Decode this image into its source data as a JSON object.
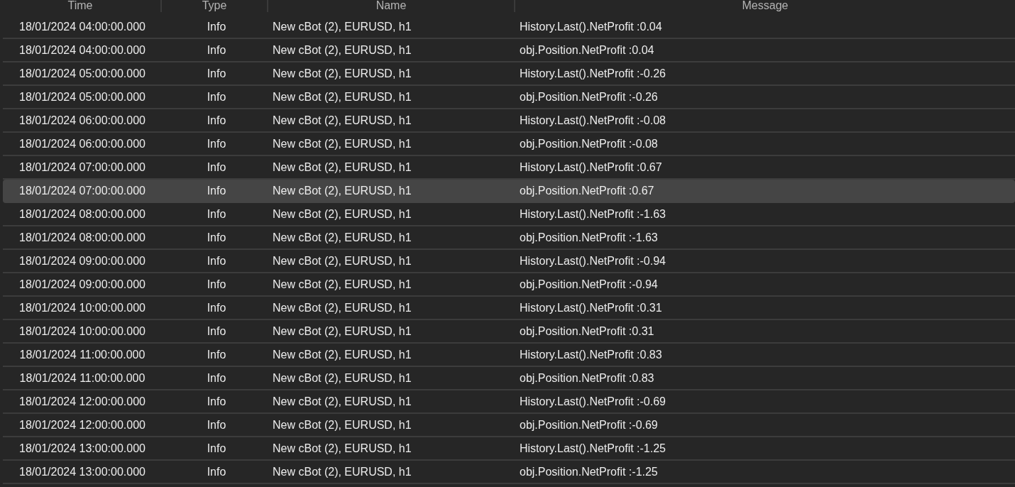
{
  "table": {
    "columns": [
      "Time",
      "Type",
      "Name",
      "Message"
    ],
    "rows": [
      {
        "time": "18/01/2024 04:00:00.000",
        "type": "Info",
        "name": "New cBot (2), EURUSD, h1",
        "message": "History.Last().NetProfit :0.04",
        "selected": false
      },
      {
        "time": "18/01/2024 04:00:00.000",
        "type": "Info",
        "name": "New cBot (2), EURUSD, h1",
        "message": "obj.Position.NetProfit :0.04",
        "selected": false
      },
      {
        "time": "18/01/2024 05:00:00.000",
        "type": "Info",
        "name": "New cBot (2), EURUSD, h1",
        "message": "History.Last().NetProfit :-0.26",
        "selected": false
      },
      {
        "time": "18/01/2024 05:00:00.000",
        "type": "Info",
        "name": "New cBot (2), EURUSD, h1",
        "message": "obj.Position.NetProfit :-0.26",
        "selected": false
      },
      {
        "time": "18/01/2024 06:00:00.000",
        "type": "Info",
        "name": "New cBot (2), EURUSD, h1",
        "message": "History.Last().NetProfit :-0.08",
        "selected": false
      },
      {
        "time": "18/01/2024 06:00:00.000",
        "type": "Info",
        "name": "New cBot (2), EURUSD, h1",
        "message": "obj.Position.NetProfit :-0.08",
        "selected": false
      },
      {
        "time": "18/01/2024 07:00:00.000",
        "type": "Info",
        "name": "New cBot (2), EURUSD, h1",
        "message": "History.Last().NetProfit :0.67",
        "selected": false
      },
      {
        "time": "18/01/2024 07:00:00.000",
        "type": "Info",
        "name": "New cBot (2), EURUSD, h1",
        "message": "obj.Position.NetProfit :0.67",
        "selected": true
      },
      {
        "time": "18/01/2024 08:00:00.000",
        "type": "Info",
        "name": "New cBot (2), EURUSD, h1",
        "message": "History.Last().NetProfit :-1.63",
        "selected": false
      },
      {
        "time": "18/01/2024 08:00:00.000",
        "type": "Info",
        "name": "New cBot (2), EURUSD, h1",
        "message": "obj.Position.NetProfit :-1.63",
        "selected": false
      },
      {
        "time": "18/01/2024 09:00:00.000",
        "type": "Info",
        "name": "New cBot (2), EURUSD, h1",
        "message": "History.Last().NetProfit :-0.94",
        "selected": false
      },
      {
        "time": "18/01/2024 09:00:00.000",
        "type": "Info",
        "name": "New cBot (2), EURUSD, h1",
        "message": "obj.Position.NetProfit :-0.94",
        "selected": false
      },
      {
        "time": "18/01/2024 10:00:00.000",
        "type": "Info",
        "name": "New cBot (2), EURUSD, h1",
        "message": "History.Last().NetProfit :0.31",
        "selected": false
      },
      {
        "time": "18/01/2024 10:00:00.000",
        "type": "Info",
        "name": "New cBot (2), EURUSD, h1",
        "message": "obj.Position.NetProfit :0.31",
        "selected": false
      },
      {
        "time": "18/01/2024 11:00:00.000",
        "type": "Info",
        "name": "New cBot (2), EURUSD, h1",
        "message": "History.Last().NetProfit :0.83",
        "selected": false
      },
      {
        "time": "18/01/2024 11:00:00.000",
        "type": "Info",
        "name": "New cBot (2), EURUSD, h1",
        "message": "obj.Position.NetProfit :0.83",
        "selected": false
      },
      {
        "time": "18/01/2024 12:00:00.000",
        "type": "Info",
        "name": "New cBot (2), EURUSD, h1",
        "message": "History.Last().NetProfit :-0.69",
        "selected": false
      },
      {
        "time": "18/01/2024 12:00:00.000",
        "type": "Info",
        "name": "New cBot (2), EURUSD, h1",
        "message": "obj.Position.NetProfit :-0.69",
        "selected": false
      },
      {
        "time": "18/01/2024 13:00:00.000",
        "type": "Info",
        "name": "New cBot (2), EURUSD, h1",
        "message": "History.Last().NetProfit :-1.25",
        "selected": false
      },
      {
        "time": "18/01/2024 13:00:00.000",
        "type": "Info",
        "name": "New cBot (2), EURUSD, h1",
        "message": "obj.Position.NetProfit :-1.25",
        "selected": false
      }
    ]
  }
}
